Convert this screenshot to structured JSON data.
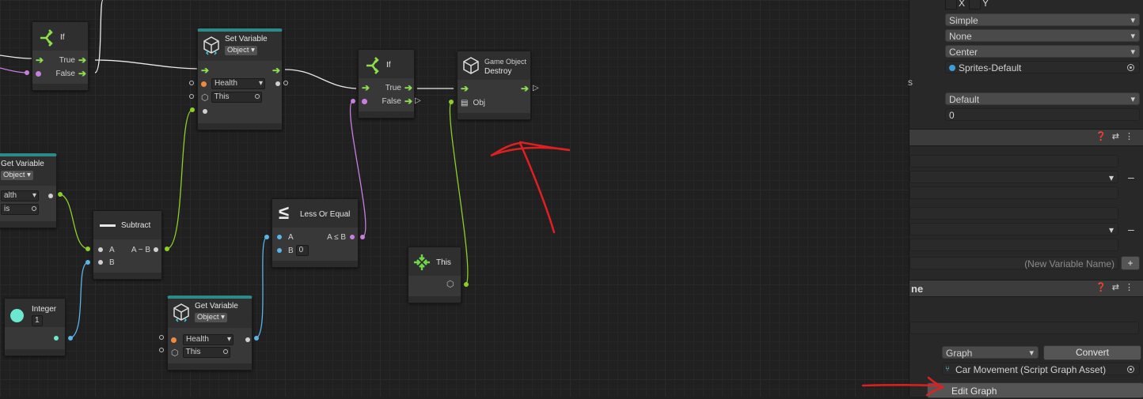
{
  "graph": {
    "if1": {
      "title": "If",
      "true_label": "True",
      "false_label": "False"
    },
    "set_variable": {
      "title": "Set Variable",
      "kind": "Object",
      "name_value": "Health",
      "target_value": "This"
    },
    "if2": {
      "title": "If",
      "true_label": "True",
      "false_label": "False"
    },
    "destroy": {
      "subtitle": "Game Object",
      "title": "Destroy",
      "port_label": "Obj"
    },
    "get_variable1": {
      "title": "Get Variable",
      "kind": "Object",
      "name_value": "alth",
      "target_value": "is"
    },
    "subtract": {
      "title": "Subtract",
      "a_label": "A",
      "out_label": "A − B",
      "b_label": "B"
    },
    "less_or_equal": {
      "title": "Less Or Equal",
      "a_label": "A",
      "out_label": "A ≤ B",
      "b_label": "B",
      "b_value": "0"
    },
    "this_node": {
      "title": "This"
    },
    "integer": {
      "title": "Integer",
      "value": "1"
    },
    "get_variable2": {
      "title": "Get Variable",
      "kind": "Object",
      "name_value": "Health",
      "target_value": "This"
    }
  },
  "inspector": {
    "flip": {
      "x_label": "X",
      "y_label": "Y"
    },
    "draw_mode": "Simple",
    "mask_interaction": "None",
    "sprite_sort_point": "Center",
    "material": "Sprites-Default",
    "partial_label": "s",
    "sorting_layer": "Default",
    "order_in_layer": "0",
    "variables_section": {
      "new_variable_placeholder": "(New Variable Name)",
      "add_label": "+"
    },
    "machine_section": {
      "title": "ne",
      "source": "Graph",
      "convert_label": "Convert",
      "graph_asset": "Car Movement (Script Graph Asset)",
      "edit_graph_label": "Edit Graph"
    }
  },
  "colors": {
    "flow": "#8be04c",
    "string_port": "#f08a3c",
    "object_port": "#c97fe0",
    "float_port": "#8ad028",
    "int_port": "#5ab4e8",
    "accent_teal": "#2d8a8a",
    "annotation": "#e02020"
  }
}
